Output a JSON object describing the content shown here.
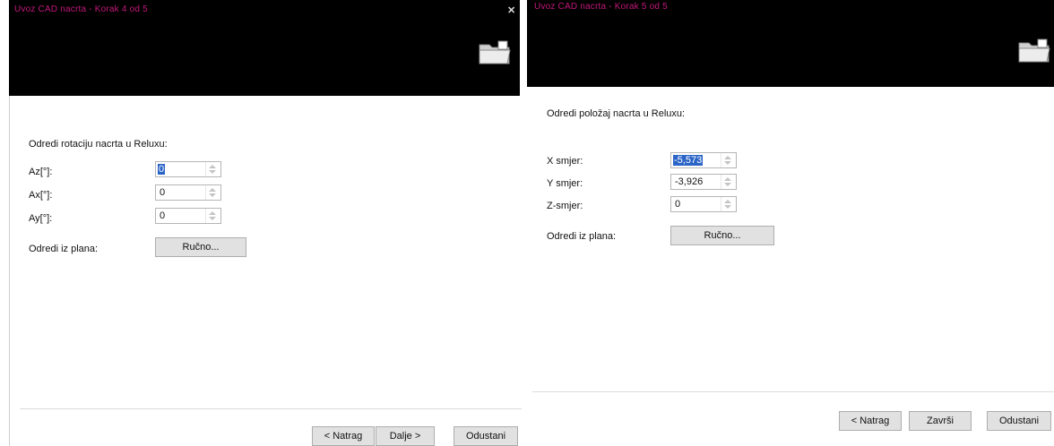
{
  "left": {
    "title": "Uvoz CAD nacrta - Korak 4 od 5",
    "heading": "Odredi rotaciju nacrta u Reluxu:",
    "fields": [
      {
        "label": "Az[°]:",
        "value": "0"
      },
      {
        "label": "Ax[°]:",
        "value": "0"
      },
      {
        "label": "Ay[°]:",
        "value": "0"
      }
    ],
    "plan_label": "Odredi iz plana:",
    "manual_button": "Ručno...",
    "back_button": "< Natrag",
    "next_button": "Dalje >",
    "cancel_button": "Odustani"
  },
  "right": {
    "close_glyph": "✕",
    "title": "Uvoz CAD nacrta - Korak 5 od 5",
    "heading": "Odredi položaj nacrta u Reluxu:",
    "fields": [
      {
        "label": "X smjer:",
        "value": "-5,573"
      },
      {
        "label": "Y smjer:",
        "value": "-3,926"
      },
      {
        "label": "Z-smjer:",
        "value": "0"
      }
    ],
    "plan_label": "Odredi iz plana:",
    "manual_button": "Ručno...",
    "back_button": "< Natrag",
    "finish_button": "Završi",
    "cancel_button": "Odustani"
  },
  "colors": {
    "title_text": "#c2187a",
    "header_bg": "#000000",
    "selection": "#2b64c7"
  },
  "icons": {
    "header_icon": "folder-icon",
    "spin_icon": "spin-arrows-icon"
  }
}
